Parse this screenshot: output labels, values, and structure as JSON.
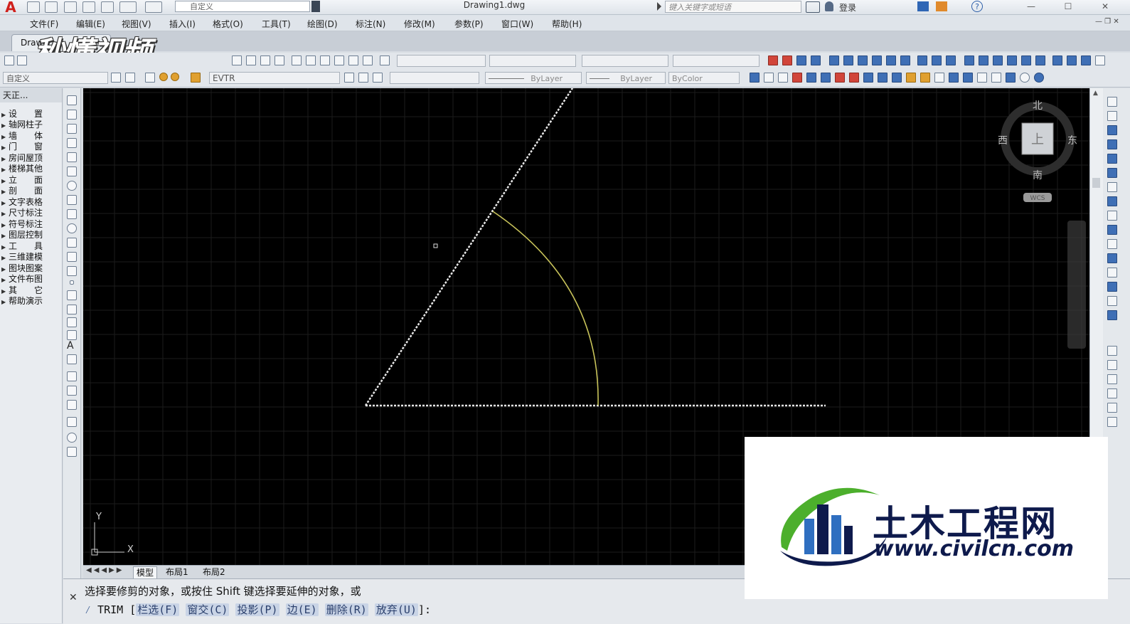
{
  "app": {
    "logo": "A",
    "document_title": "Drawing1.dwg",
    "workspace": "自定义",
    "search_placeholder": "键入关键字或短语",
    "login": "登录"
  },
  "menu": [
    "文件(F)",
    "编辑(E)",
    "视图(V)",
    "插入(I)",
    "格式(O)",
    "工具(T)",
    "绘图(D)",
    "标注(N)",
    "修改(M)",
    "参数(P)",
    "窗口(W)",
    "帮助(H)"
  ],
  "tabs": {
    "drawing_tab": "Draw"
  },
  "watermark": {
    "top_left": "秒懂视频"
  },
  "toolbar2": {
    "style_combo": "自定义",
    "layer_combo": "EVTR",
    "linetype": "ByLayer",
    "lineweight": "ByLayer",
    "plotstyle": "ByColor"
  },
  "left_panel": {
    "title": "天正...",
    "items": [
      "设　　置",
      "轴网柱子",
      "墙　　体",
      "门　　窗",
      "房间屋顶",
      "楼梯其他",
      "立　　面",
      "剖　　面",
      "文字表格",
      "尺寸标注",
      "符号标注",
      "图层控制",
      "工　　具",
      "三维建模",
      "图块图案",
      "文件布图",
      "其　　它",
      "帮助演示"
    ]
  },
  "viewcube": {
    "north": "北",
    "south": "南",
    "east": "东",
    "west": "西",
    "face": "上",
    "wcs": "WCS"
  },
  "ucs": {
    "x": "X",
    "y": "Y"
  },
  "layout_tabs": [
    "模型",
    "布局1",
    "布局2"
  ],
  "command": {
    "line1": "选择要修剪的对象，或按住 Shift 键选择要延伸的对象，或",
    "prefix": "TRIM [",
    "options": [
      "栏选(F)",
      "窗交(C)",
      "投影(P)",
      "边(E)",
      "删除(R)",
      "放弃(U)"
    ],
    "suffix": "]:"
  },
  "brand": {
    "name": "土木工程网",
    "url": "www.civilcn.com"
  },
  "colors": {
    "canvas_bg": "#000000",
    "grid": "#1c1c1c",
    "line": "#e8e8e8",
    "arc": "#c8c35a",
    "brand_navy": "#0e1a4c",
    "brand_green": "#4caf2c",
    "brand_blue": "#2f6fc0"
  }
}
